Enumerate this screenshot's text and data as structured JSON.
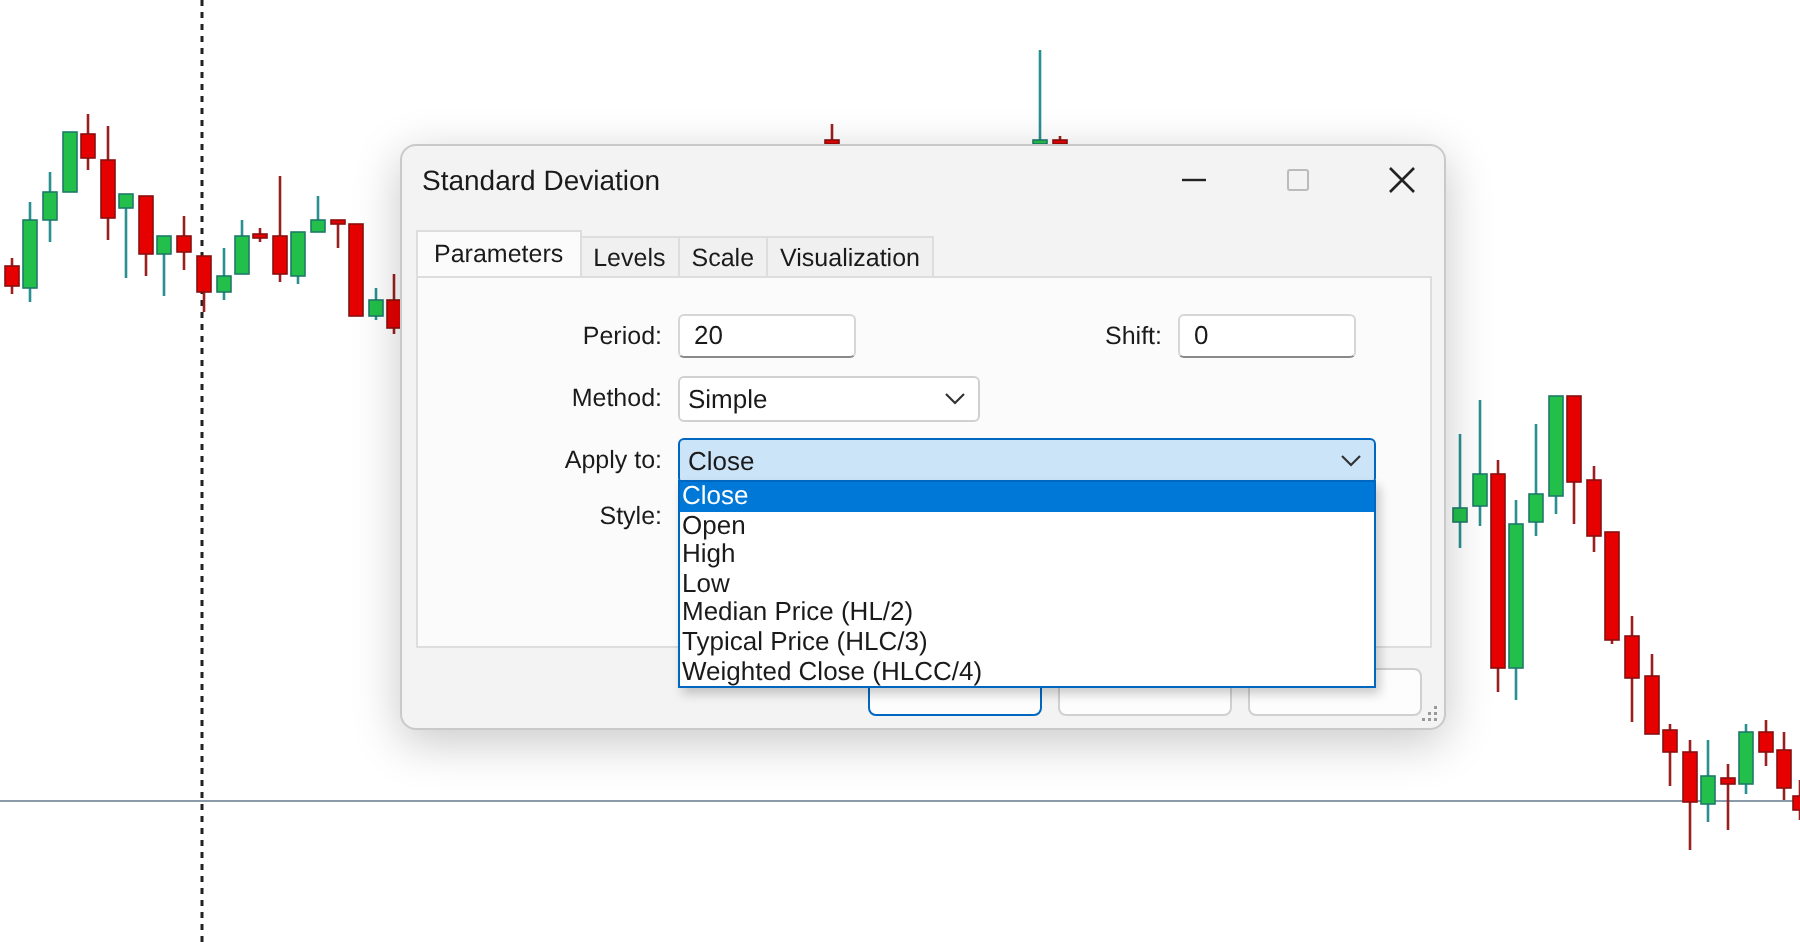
{
  "window": {
    "title": "Standard Deviation",
    "maximize_disabled": true
  },
  "tabs": [
    {
      "label": "Parameters",
      "selected": true
    },
    {
      "label": "Levels",
      "selected": false
    },
    {
      "label": "Scale",
      "selected": false
    },
    {
      "label": "Visualization",
      "selected": false
    }
  ],
  "period": {
    "label": "Period:",
    "value": "20"
  },
  "shift": {
    "label": "Shift:",
    "value": "0"
  },
  "method": {
    "label": "Method:",
    "value": "Simple"
  },
  "apply_to": {
    "label": "Apply to:",
    "value": "Close",
    "expanded": true,
    "options": [
      {
        "label": "Close",
        "selected": true
      },
      {
        "label": "Open",
        "selected": false
      },
      {
        "label": "High",
        "selected": false
      },
      {
        "label": "Low",
        "selected": false
      },
      {
        "label": "Median Price (HL/2)",
        "selected": false
      },
      {
        "label": "Typical Price (HLC/3)",
        "selected": false
      },
      {
        "label": "Weighted Close (HLCC/4)",
        "selected": false
      }
    ]
  },
  "style": {
    "label": "Style:"
  },
  "buttons": [
    {
      "default": true
    },
    {
      "default": false
    },
    {
      "default": false
    }
  ]
}
